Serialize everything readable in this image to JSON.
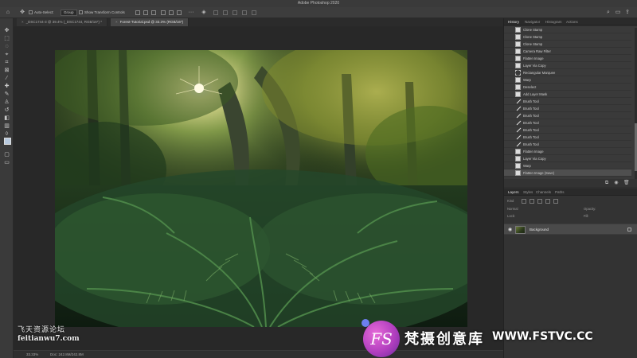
{
  "app": {
    "title": "Adobe Photoshop 2020"
  },
  "options_bar": {
    "auto_select_label": "Auto-Select:",
    "auto_select_value": "Group",
    "transform_controls_label": "Show Transform Controls"
  },
  "tabs": [
    {
      "label": "_DSC1744-3 @ 39.4% (_DSC1744, RGB/16*) *",
      "active": false
    },
    {
      "label": "Forest-Tutorial.psd @ 33.3% (RGB/16*)",
      "active": true
    }
  ],
  "status": {
    "zoom": "33.33%",
    "doc": "Doc: 242.8M/242.8M"
  },
  "history_panel": {
    "tabs": [
      "History",
      "Navigator",
      "Histogram",
      "Actions"
    ],
    "active_tab": "History",
    "items": [
      {
        "label": "Clone Stamp",
        "icon": "doc"
      },
      {
        "label": "Clone Stamp",
        "icon": "doc"
      },
      {
        "label": "Clone Stamp",
        "icon": "doc"
      },
      {
        "label": "Camera Raw Filter",
        "icon": "doc"
      },
      {
        "label": "Flatten Image",
        "icon": "doc"
      },
      {
        "label": "Layer Via Copy",
        "icon": "doc"
      },
      {
        "label": "Rectangular Marquee",
        "icon": "marquee"
      },
      {
        "label": "Warp",
        "icon": "doc"
      },
      {
        "label": "Deselect",
        "icon": "doc"
      },
      {
        "label": "Add Layer Mask",
        "icon": "doc"
      },
      {
        "label": "Brush Tool",
        "icon": "brush"
      },
      {
        "label": "Brush Tool",
        "icon": "brush"
      },
      {
        "label": "Brush Tool",
        "icon": "brush"
      },
      {
        "label": "Brush Tool",
        "icon": "brush"
      },
      {
        "label": "Brush Tool",
        "icon": "brush"
      },
      {
        "label": "Brush Tool",
        "icon": "brush"
      },
      {
        "label": "Brush Tool",
        "icon": "brush"
      },
      {
        "label": "Flatten Image",
        "icon": "doc"
      },
      {
        "label": "Layer Via Copy",
        "icon": "doc"
      },
      {
        "label": "Warp",
        "icon": "doc"
      },
      {
        "label": "Flatten Image (Save)",
        "icon": "doc",
        "selected": true
      }
    ]
  },
  "layers_panel": {
    "tabs": [
      "Layers",
      "Styles",
      "Channels",
      "Paths"
    ],
    "active_tab": "Layers",
    "kind_label": "Kind",
    "mode_label": "Normal",
    "opacity_label": "Opacity:",
    "lock_label": "Lock:",
    "fill_label": "Fill:",
    "layers": [
      {
        "name": "Background",
        "visible": true,
        "locked": true
      }
    ]
  },
  "watermarks": {
    "left_cn": "飞天资源论坛",
    "left_en": "feitianwu7.com",
    "right_logo": "FS",
    "right_cn": "梵摄创意库",
    "right_url": "WWW.FSTVC.CC"
  },
  "colors": {
    "foreground": "#b7c9de",
    "background": "#ffffff",
    "accent_logo": "#c24fd0"
  }
}
